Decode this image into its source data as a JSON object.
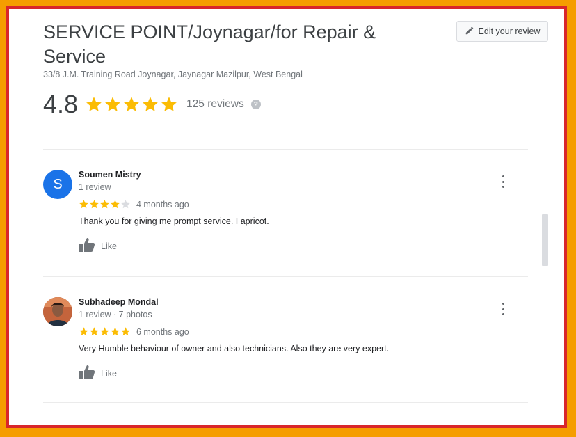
{
  "place": {
    "title": "SERVICE POINT/Joynagar/for Repair & Service",
    "address": "33/8 J.M. Training Road Joynagar, Jaynagar Mazilpur, West Bengal",
    "rating": "4.8",
    "rating_value": 4.8,
    "reviews_count": "125 reviews",
    "help_glyph": "?"
  },
  "edit_review": {
    "label": "Edit your review",
    "icon": "pencil-icon"
  },
  "colors": {
    "star": "#fbbc04",
    "star_empty": "#dadce0",
    "avatar_blue": "#1a73e8"
  },
  "reviews": [
    {
      "avatar_letter": "S",
      "name": "Soumen Mistry",
      "meta": "1 review",
      "stars": 4,
      "date": "4 months ago",
      "text": "Thank you for giving me prompt service. I apricot.",
      "like_label": "Like"
    },
    {
      "avatar_letter": "",
      "name": "Subhadeep Mondal",
      "meta": "1 review · 7 photos",
      "stars": 5,
      "date": "6 months ago",
      "text": "Very Humble behaviour of owner and also technicians. Also they are very expert.",
      "like_label": "Like"
    }
  ]
}
